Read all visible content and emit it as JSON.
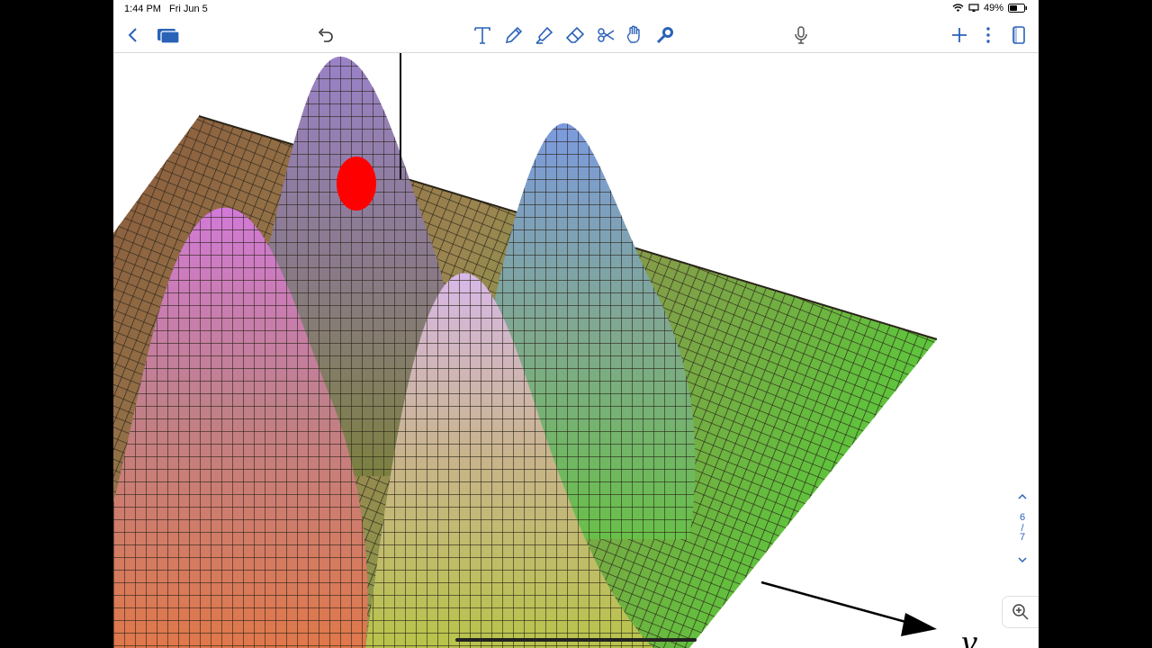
{
  "status_bar": {
    "time": "1:44 PM",
    "date": "Fri Jun 5",
    "battery": "49%"
  },
  "toolbar": {
    "icons": [
      "back-icon",
      "pages-icon",
      "undo-icon",
      "text-tool-icon",
      "pen-icon",
      "highlighter-icon",
      "eraser-icon",
      "lasso-icon",
      "hand-icon",
      "laser-pointer-icon",
      "microphone-icon",
      "add-icon",
      "more-icon",
      "document-icon"
    ],
    "accent_color": "#2a62b8"
  },
  "page": {
    "current": "6",
    "total": "7",
    "separator": "/"
  },
  "figure": {
    "axis_label": "y"
  },
  "annotation_color": "#ff0000"
}
